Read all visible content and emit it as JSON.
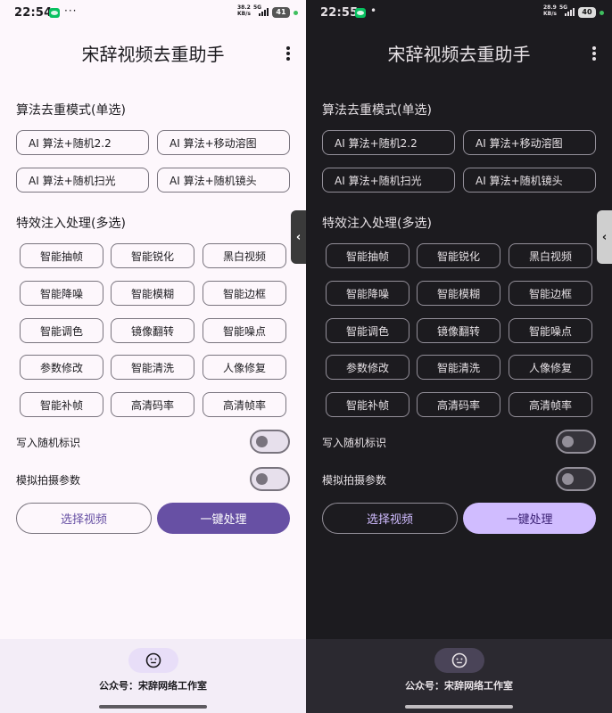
{
  "screens": [
    {
      "status": {
        "time": "22:54",
        "speed_value": "38.2",
        "speed_unit": "KB/s",
        "network": "5G",
        "battery": "41"
      },
      "title": "宋辞视频去重助手"
    },
    {
      "status": {
        "time": "22:55",
        "speed_value": "28.9",
        "speed_unit": "KB/s",
        "network": "5G",
        "battery": "40"
      },
      "title": "宋辞视频去重助手"
    }
  ],
  "algo": {
    "heading": "算法去重模式(单选)",
    "options": [
      "AI 算法+随机2.2",
      "AI 算法+移动溶图",
      "AI 算法+随机扫光",
      "AI 算法+随机镜头"
    ]
  },
  "effects": {
    "heading": "特效注入处理(多选)",
    "items": [
      "智能抽帧",
      "智能锐化",
      "黑白视频",
      "智能降噪",
      "智能模糊",
      "智能边框",
      "智能调色",
      "镜像翻转",
      "智能噪点",
      "参数修改",
      "智能清洗",
      "人像修复",
      "智能补帧",
      "高清码率",
      "高清帧率"
    ]
  },
  "toggles": [
    {
      "label": "写入随机标识",
      "on": false
    },
    {
      "label": "模拟拍摄参数",
      "on": false
    }
  ],
  "actions": {
    "select": "选择视频",
    "process": "一键处理"
  },
  "footer": {
    "text": "公众号：宋辞网络工作室"
  },
  "icons": {
    "menu": "more-vert-icon",
    "face": "face-icon",
    "edge": "chevron-left-icon"
  },
  "colors": {
    "primary_light": "#6750a4",
    "primary_dark": "#d0bcff",
    "bg_light": "#fdf7fc",
    "bg_dark": "#1c1b1f"
  }
}
